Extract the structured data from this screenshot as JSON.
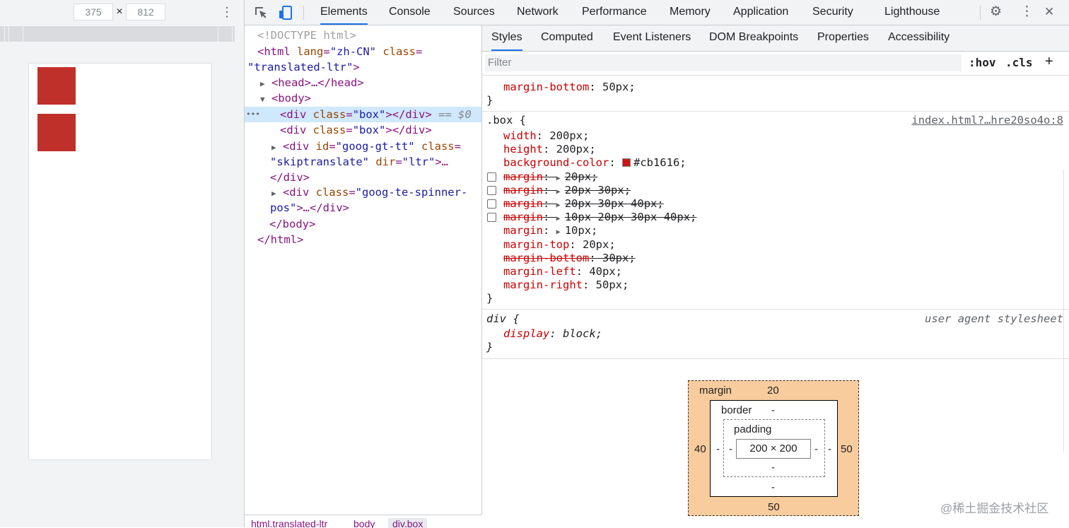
{
  "device": {
    "width": "375",
    "height": "812",
    "times": "×",
    "more": "⋮",
    "box_color": "#c0302a"
  },
  "toolbar": {
    "tabs": [
      "Elements",
      "Console",
      "Sources",
      "Network",
      "Performance",
      "Memory",
      "Application",
      "Security",
      "Lighthouse"
    ],
    "active_tab": "Elements",
    "settings": "⚙",
    "more": "⋮",
    "close": "✕"
  },
  "dom": {
    "doctype": "<!DOCTYPE html>",
    "html_open_1": "<html",
    "html_lang_attr": "lang",
    "html_lang_val": "\"zh-CN\"",
    "html_class_attr": "class",
    "html_class_val": "\"translated-ltr\"",
    "head": "<head>…</head>",
    "body_open": "<body>",
    "div1": "<div",
    "div1_class_attr": "class",
    "div1_class_val": "\"box\"",
    "div1_close": "></div>",
    "div1_eq": "== $0",
    "div2": "<div",
    "div2_class_attr": "class",
    "div2_class_val": "\"box\"",
    "div2_close": "></div>",
    "div3": "<div",
    "div3_id_attr": "id",
    "div3_id_val": "\"goog-gt-tt\"",
    "div3_class_attr": "class",
    "div3_class_val": "\"skiptranslate\"",
    "div3_dir_attr": "dir",
    "div3_dir_val": "\"ltr\"",
    "div3_rest": ">…",
    "div3_close": "</div>",
    "div4": "<div",
    "div4_class_attr": "class",
    "div4_class_val_1": "\"goog-te-spinner-",
    "div4_class_val_2": "pos\"",
    "div4_rest": ">…</div>",
    "body_close": "</body>",
    "html_close": "</html>",
    "ellipsis": "•••"
  },
  "breadcrumb": [
    "html.translated-ltr",
    "body",
    "div.box"
  ],
  "styles": {
    "tabs": [
      "Styles",
      "Computed",
      "Event Listeners",
      "DOM Breakpoints",
      "Properties",
      "Accessibility"
    ],
    "active_tab": "Styles",
    "filter_placeholder": "Filter",
    "hov": ":hov",
    "cls": ".cls",
    "plus": "+",
    "prev_rule": {
      "prop": "margin-bottom",
      "val": "50px;",
      "close": "}"
    },
    "box_rule": {
      "selector": ".box",
      "source": "index.html?…hre20so4o:8",
      "open": "{",
      "close": "}",
      "decls": [
        {
          "prop": "width",
          "val": "200px;",
          "strike": false,
          "checkbox": false
        },
        {
          "prop": "height",
          "val": "200px;",
          "strike": false,
          "checkbox": false
        },
        {
          "prop": "background-color",
          "val": "#cb1616;",
          "strike": false,
          "checkbox": false,
          "swatch": "#cb1616"
        },
        {
          "prop": "margin",
          "val": "20px;",
          "strike": true,
          "checkbox": true,
          "arrow": true
        },
        {
          "prop": "margin",
          "val": "20px 30px;",
          "strike": true,
          "checkbox": true,
          "arrow": true
        },
        {
          "prop": "margin",
          "val": "20px 30px 40px;",
          "strike": true,
          "checkbox": true,
          "arrow": true
        },
        {
          "prop": "margin",
          "val": "10px 20px 30px 40px;",
          "strike": true,
          "checkbox": true,
          "arrow": true
        },
        {
          "prop": "margin",
          "val": "10px;",
          "strike": false,
          "checkbox": false,
          "arrow": true
        },
        {
          "prop": "margin-top",
          "val": "20px;",
          "strike": false,
          "checkbox": false
        },
        {
          "prop": "margin-bottom",
          "val": "30px;",
          "strike": true,
          "checkbox": false
        },
        {
          "prop": "margin-left",
          "val": "40px;",
          "strike": false,
          "checkbox": false
        },
        {
          "prop": "margin-right",
          "val": "50px;",
          "strike": false,
          "checkbox": false
        }
      ]
    },
    "ua_rule": {
      "selector": "div",
      "source": "user agent stylesheet",
      "open": "{",
      "close": "}",
      "prop": "display",
      "val": "block;"
    }
  },
  "box_model": {
    "margin_label": "margin",
    "margin_top": "20",
    "margin_left": "40",
    "margin_right": "50",
    "margin_bottom": "50",
    "border_label": "border",
    "border_top": "-",
    "border_left": "-",
    "border_right": "-",
    "border_bottom": "-",
    "padding_label": "padding",
    "padding_left": "-",
    "padding_right": "-",
    "padding_bottom": "-",
    "content": "200 × 200"
  },
  "watermark": "@稀土掘金技术社区"
}
